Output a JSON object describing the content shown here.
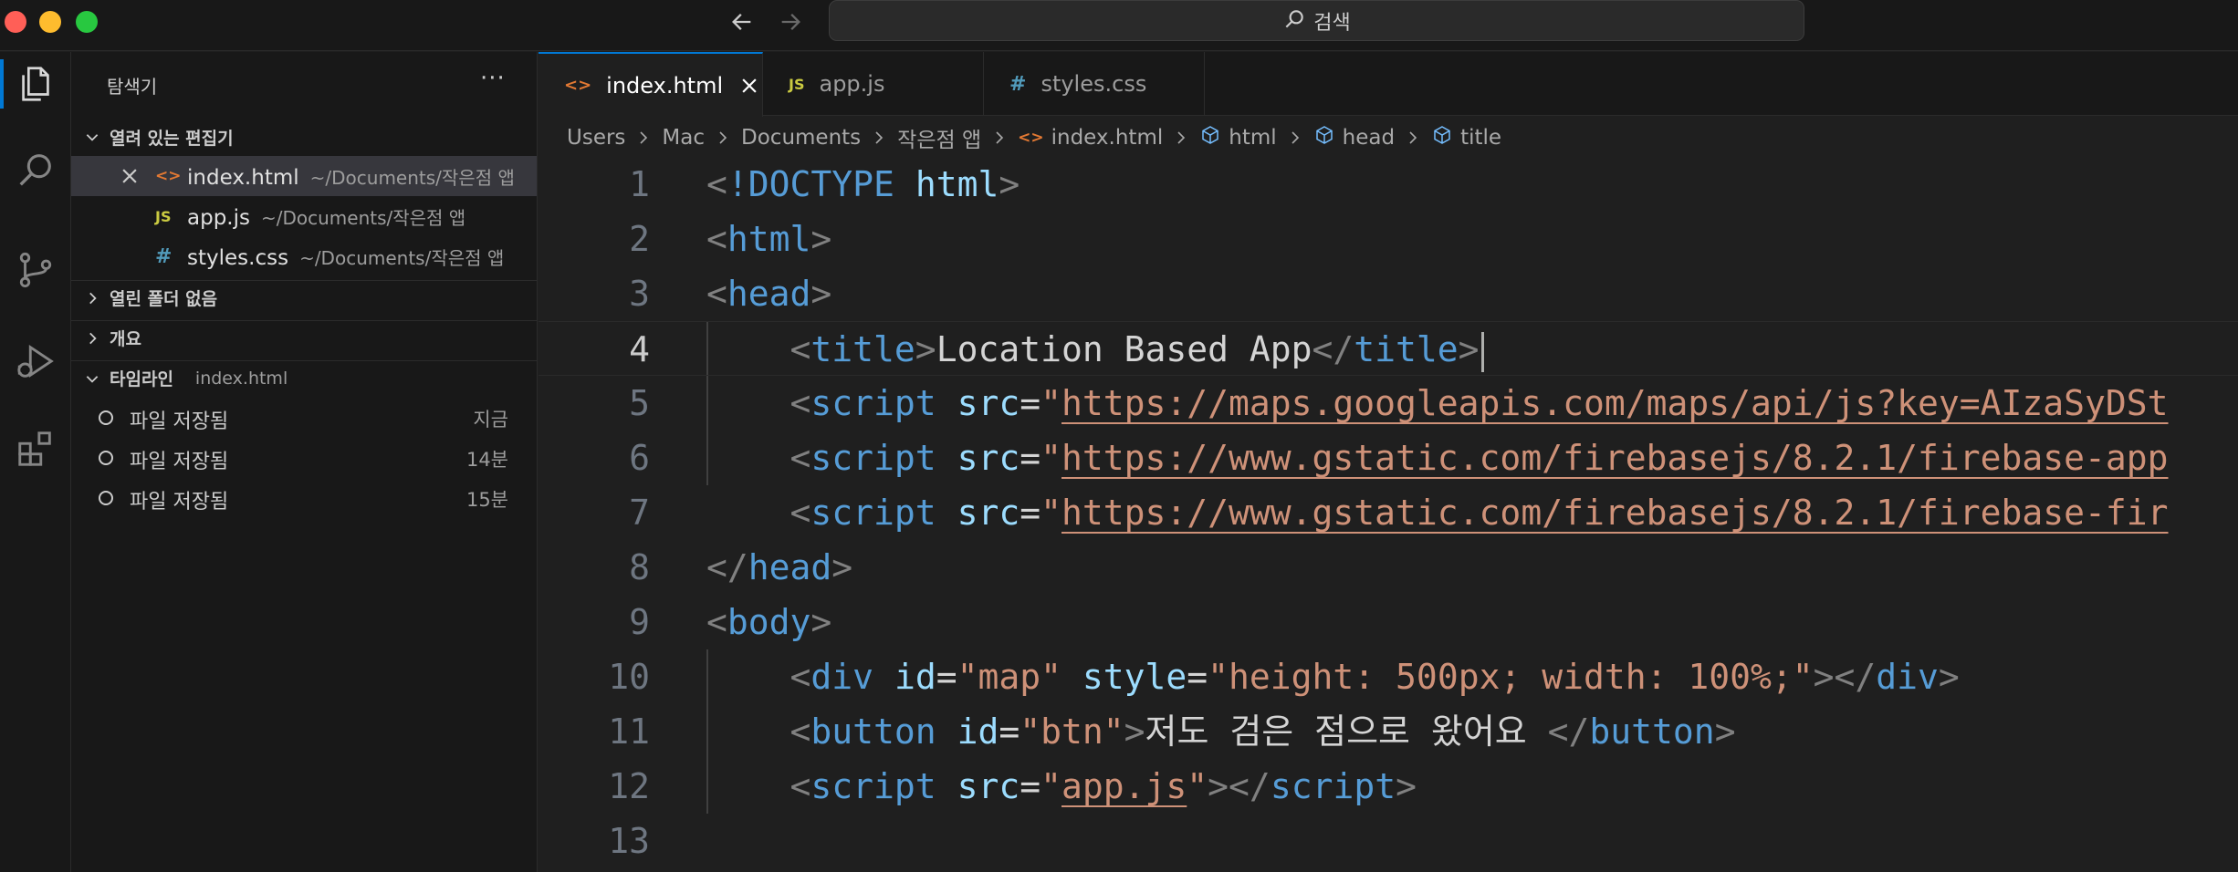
{
  "titlebar": {
    "search_label": "검색"
  },
  "sidebar": {
    "title": "탐색기",
    "more": "···",
    "open_editors": {
      "label": "열려 있는 편집기",
      "items": [
        {
          "icon": "<>",
          "name": "index.html",
          "path": "~/Documents/작은점 앱"
        },
        {
          "icon": "JS",
          "name": "app.js",
          "path": "~/Documents/작은점 앱"
        },
        {
          "icon": "#",
          "name": "styles.css",
          "path": "~/Documents/작은점 앱"
        }
      ]
    },
    "no_folder": {
      "label": "열린 폴더 없음"
    },
    "outline": {
      "label": "개요"
    },
    "timeline": {
      "label": "타임라인",
      "file": "index.html",
      "items": [
        {
          "label": "파일 저장됨",
          "time": "지금"
        },
        {
          "label": "파일 저장됨",
          "time": "14분"
        },
        {
          "label": "파일 저장됨",
          "time": "15분"
        }
      ]
    }
  },
  "tabs": [
    {
      "icon": "<>",
      "label": "index.html",
      "active": true
    },
    {
      "icon": "JS",
      "label": "app.js",
      "active": false
    },
    {
      "icon": "#",
      "label": "styles.css",
      "active": false
    }
  ],
  "breadcrumb": [
    "Users",
    "Mac",
    "Documents",
    "작은점 앱",
    "index.html",
    "html",
    "head",
    "title"
  ],
  "editor": {
    "current_line": 4,
    "lines": [
      {
        "n": "1",
        "indent": "",
        "tokens": [
          [
            "t-punc",
            "<"
          ],
          [
            "t-doc",
            "!DOCTYPE"
          ],
          [
            "t-text",
            " "
          ],
          [
            "t-attr",
            "html"
          ],
          [
            "t-punc",
            ">"
          ]
        ]
      },
      {
        "n": "2",
        "indent": "",
        "tokens": [
          [
            "t-punc",
            "<"
          ],
          [
            "t-tag",
            "html"
          ],
          [
            "t-punc",
            ">"
          ]
        ]
      },
      {
        "n": "3",
        "indent": "",
        "tokens": [
          [
            "t-punc",
            "<"
          ],
          [
            "t-tag",
            "head"
          ],
          [
            "t-punc",
            ">"
          ]
        ]
      },
      {
        "n": "4",
        "indent": "    ",
        "tokens": [
          [
            "t-punc",
            "<"
          ],
          [
            "t-tag",
            "title"
          ],
          [
            "t-punc",
            ">"
          ],
          [
            "t-text",
            "Location Based App"
          ],
          [
            "t-punc",
            "</"
          ],
          [
            "t-tag",
            "title"
          ],
          [
            "t-punc",
            ">"
          ]
        ]
      },
      {
        "n": "5",
        "indent": "    ",
        "tokens": [
          [
            "t-punc",
            "<"
          ],
          [
            "t-tag",
            "script"
          ],
          [
            "t-text",
            " "
          ],
          [
            "t-attr",
            "src"
          ],
          [
            "t-text",
            "="
          ],
          [
            "t-str",
            "\""
          ],
          [
            "t-link",
            "https://maps.googleapis.com/maps/api/js?key=AIzaSyDSt"
          ]
        ]
      },
      {
        "n": "6",
        "indent": "    ",
        "tokens": [
          [
            "t-punc",
            "<"
          ],
          [
            "t-tag",
            "script"
          ],
          [
            "t-text",
            " "
          ],
          [
            "t-attr",
            "src"
          ],
          [
            "t-text",
            "="
          ],
          [
            "t-str",
            "\""
          ],
          [
            "t-link",
            "https://www.gstatic.com/firebasejs/8.2.1/firebase-app"
          ]
        ]
      },
      {
        "n": "7",
        "indent": "    ",
        "tokens": [
          [
            "t-punc",
            "<"
          ],
          [
            "t-tag",
            "script"
          ],
          [
            "t-text",
            " "
          ],
          [
            "t-attr",
            "src"
          ],
          [
            "t-text",
            "="
          ],
          [
            "t-str",
            "\""
          ],
          [
            "t-link",
            "https://www.gstatic.com/firebasejs/8.2.1/firebase-fir"
          ]
        ]
      },
      {
        "n": "8",
        "indent": "",
        "tokens": [
          [
            "t-punc",
            "</"
          ],
          [
            "t-tag",
            "head"
          ],
          [
            "t-punc",
            ">"
          ]
        ]
      },
      {
        "n": "9",
        "indent": "",
        "tokens": [
          [
            "t-punc",
            "<"
          ],
          [
            "t-tag",
            "body"
          ],
          [
            "t-punc",
            ">"
          ]
        ]
      },
      {
        "n": "10",
        "indent": "    ",
        "tokens": [
          [
            "t-punc",
            "<"
          ],
          [
            "t-tag",
            "div"
          ],
          [
            "t-text",
            " "
          ],
          [
            "t-attr",
            "id"
          ],
          [
            "t-text",
            "="
          ],
          [
            "t-str",
            "\"map\""
          ],
          [
            "t-text",
            " "
          ],
          [
            "t-attr",
            "style"
          ],
          [
            "t-text",
            "="
          ],
          [
            "t-str",
            "\"height: 500px; width: 100%;\""
          ],
          [
            "t-punc",
            "></"
          ],
          [
            "t-tag",
            "div"
          ],
          [
            "t-punc",
            ">"
          ]
        ]
      },
      {
        "n": "11",
        "indent": "    ",
        "tokens": [
          [
            "t-punc",
            "<"
          ],
          [
            "t-tag",
            "button"
          ],
          [
            "t-text",
            " "
          ],
          [
            "t-attr",
            "id"
          ],
          [
            "t-text",
            "="
          ],
          [
            "t-str",
            "\"btn\""
          ],
          [
            "t-punc",
            ">"
          ],
          [
            "t-text",
            "저도 검은 점으로 왔어요 "
          ],
          [
            "t-punc",
            "</"
          ],
          [
            "t-tag",
            "button"
          ],
          [
            "t-punc",
            ">"
          ]
        ]
      },
      {
        "n": "12",
        "indent": "    ",
        "tokens": [
          [
            "t-punc",
            "<"
          ],
          [
            "t-tag",
            "script"
          ],
          [
            "t-text",
            " "
          ],
          [
            "t-attr",
            "src"
          ],
          [
            "t-text",
            "="
          ],
          [
            "t-str",
            "\""
          ],
          [
            "t-link",
            "app.js"
          ],
          [
            "t-str",
            "\""
          ],
          [
            "t-punc",
            "></"
          ],
          [
            "t-tag",
            "script"
          ],
          [
            "t-punc",
            ">"
          ]
        ]
      },
      {
        "n": "13",
        "indent": "",
        "tokens": []
      }
    ]
  },
  "colors": {
    "accent": "#0078d4",
    "html_icon": "#e37933",
    "js_icon": "#cbcb41",
    "css_icon": "#519aba"
  }
}
